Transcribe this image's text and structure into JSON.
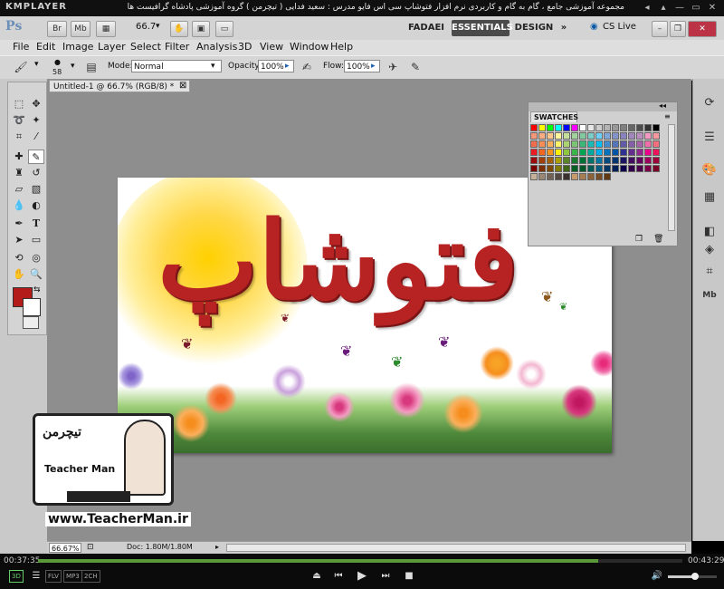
{
  "km_player": {
    "logo": "KMPLAYER",
    "caption": "مجموعه آموزشی جامع ، گام به گام و کاربردی نرم افزار فتوشاپ سی اس فایو  مدرس : سعید فدایی ( تیچرمن ) گروه آموزشی پادشاه گرافیست ها",
    "elapsed": "00:37:35",
    "total": "00:43:29",
    "progress_fraction": 0.87,
    "chips": [
      "3D",
      "FLV",
      "MP3",
      "2CH"
    ],
    "window_buttons": [
      "◂",
      "▴",
      "—",
      "▭",
      "✕"
    ]
  },
  "photoshop": {
    "logo": "Ps",
    "app_buttons": [
      "Br",
      "Mb"
    ],
    "zoom_level": "66.7",
    "workspaces": [
      "FADAEI",
      "ESSENTIALS",
      "DESIGN"
    ],
    "workspace_more": "»",
    "cs_live": "CS Live",
    "menu": [
      "File",
      "Edit",
      "Image",
      "Layer",
      "Select",
      "Filter",
      "Analysis",
      "3D",
      "View",
      "Window",
      "Help"
    ],
    "options": {
      "brush_size": "58",
      "mode_label": "Mode:",
      "mode_value": "Normal",
      "opacity_label": "Opacity:",
      "opacity_value": "100%",
      "flow_label": "Flow:",
      "flow_value": "100%"
    },
    "document_tab": "Untitled-1 @ 66.7% (RGB/8) *",
    "document_close": "⊠",
    "swatches_panel": {
      "title": "SWATCHES",
      "rows": [
        [
          "#ff0000",
          "#ffff00",
          "#00ff00",
          "#00ffff",
          "#0000ff",
          "#ff00ff",
          "#ffffff",
          "#e6e6e6",
          "#cccccc",
          "#b3b3b3",
          "#999999",
          "#808080",
          "#666666",
          "#4d4d4d",
          "#333333",
          "#000000"
        ],
        [
          "#f7977a",
          "#f9ad81",
          "#fdc68a",
          "#fff79a",
          "#c4df9b",
          "#a3d39c",
          "#82ca9d",
          "#7bcdc8",
          "#6ecff6",
          "#7ea7d8",
          "#8493ca",
          "#8882be",
          "#a187be",
          "#bc8dbf",
          "#f49ac2",
          "#f6989d"
        ],
        [
          "#f26c4f",
          "#f68e55",
          "#fbaf5c",
          "#fff467",
          "#acd372",
          "#7cc576",
          "#3bb878",
          "#1abbb4",
          "#00bff3",
          "#438ccb",
          "#5574b9",
          "#605ca8",
          "#855fa8",
          "#a763a8",
          "#f06ea9",
          "#f26d7d"
        ],
        [
          "#ed1c24",
          "#f26522",
          "#f7941d",
          "#fff200",
          "#8dc73f",
          "#39b54a",
          "#00a651",
          "#00a99d",
          "#00aeef",
          "#0072bc",
          "#0054a6",
          "#2e3192",
          "#662d91",
          "#92278f",
          "#ec008c",
          "#ed145b"
        ],
        [
          "#9e0b0f",
          "#a0410d",
          "#a3620a",
          "#aba000",
          "#598527",
          "#1a7b30",
          "#007236",
          "#00746b",
          "#0076a3",
          "#004b80",
          "#003471",
          "#1b1464",
          "#440e62",
          "#630460",
          "#9e005d",
          "#9e0039"
        ],
        [
          "#790000",
          "#7b2e00",
          "#7d4900",
          "#827b00",
          "#406618",
          "#005e20",
          "#005826",
          "#005952",
          "#005b7f",
          "#003663",
          "#002157",
          "#0d004c",
          "#32004b",
          "#4b0049",
          "#7b0046",
          "#7a0026"
        ],
        [
          "#c7b299",
          "#998675",
          "#736357",
          "#534741",
          "#37302d",
          "#c69c6d",
          "#a67c52",
          "#8c6239",
          "#754c24",
          "#603913"
        ]
      ]
    },
    "status": {
      "zoom": "66.67%",
      "doc": "Doc: 1.80M/1.80M"
    },
    "artwork_text": "فتوشاپ"
  },
  "watermark": {
    "brand_fa": "تیچرمن",
    "brand_en": "Teacher Man",
    "url": "www.TeacherMan.ir"
  },
  "colors": {
    "foreground": "#b31b1b",
    "background": "#ffffff",
    "accent_green": "#5a9a3a"
  }
}
